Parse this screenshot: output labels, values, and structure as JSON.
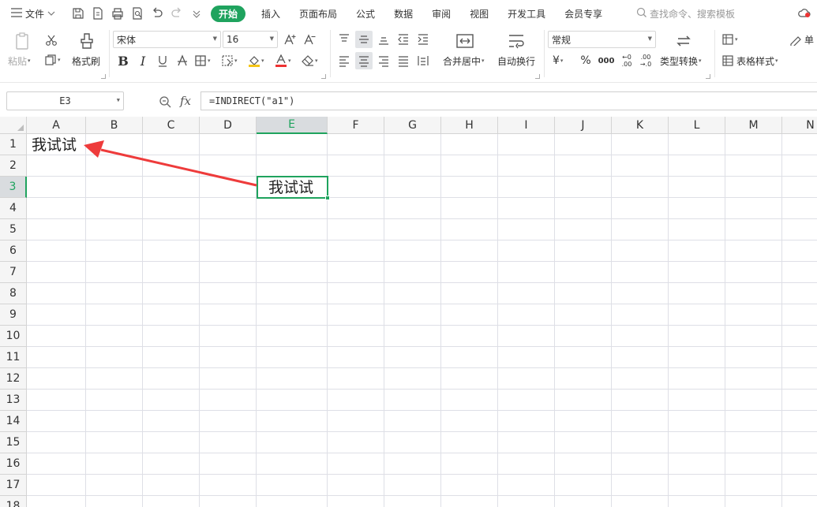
{
  "menu": {
    "file_label": "文件",
    "tabs": [
      {
        "label": "开始",
        "active": true
      },
      {
        "label": "插入",
        "active": false
      },
      {
        "label": "页面布局",
        "active": false
      },
      {
        "label": "公式",
        "active": false
      },
      {
        "label": "数据",
        "active": false
      },
      {
        "label": "审阅",
        "active": false
      },
      {
        "label": "视图",
        "active": false
      },
      {
        "label": "开发工具",
        "active": false
      },
      {
        "label": "会员专享",
        "active": false
      }
    ],
    "search_placeholder": "查找命令、搜索模板",
    "accent_color": "#1fa35e"
  },
  "ribbon": {
    "paste_label": "粘贴",
    "format_painter_label": "格式刷",
    "font_name": "宋体",
    "font_size": "16",
    "merge_center_label": "合并居中",
    "wrap_text_label": "自动换行",
    "number_format": "常规",
    "convert_label": "类型转换",
    "table_style_label": "表格样式",
    "cell_label": "单",
    "percent": "%",
    "thousands": "000",
    "inc_decimal_top": "←0",
    "inc_decimal_bottom": ".00",
    "dec_decimal_top": ".00",
    "dec_decimal_bottom": "→.0",
    "currency": "¥"
  },
  "formula_bar": {
    "name_box": "E3",
    "fx_label": "fx",
    "formula": "=INDIRECT(\"a1\")"
  },
  "sheet": {
    "columns": [
      "A",
      "B",
      "C",
      "D",
      "E",
      "F",
      "G",
      "H",
      "I",
      "J",
      "K",
      "L",
      "M",
      "N"
    ],
    "rows": [
      "1",
      "2",
      "3",
      "4",
      "5",
      "6",
      "7",
      "8",
      "9",
      "10",
      "11",
      "12",
      "13",
      "14",
      "15",
      "16",
      "17",
      "18"
    ],
    "selected_column": "E",
    "selected_row": "3",
    "cells": {
      "A1": "我试试",
      "E3": "我试试"
    },
    "annotation_color": "#ee3b3b"
  }
}
